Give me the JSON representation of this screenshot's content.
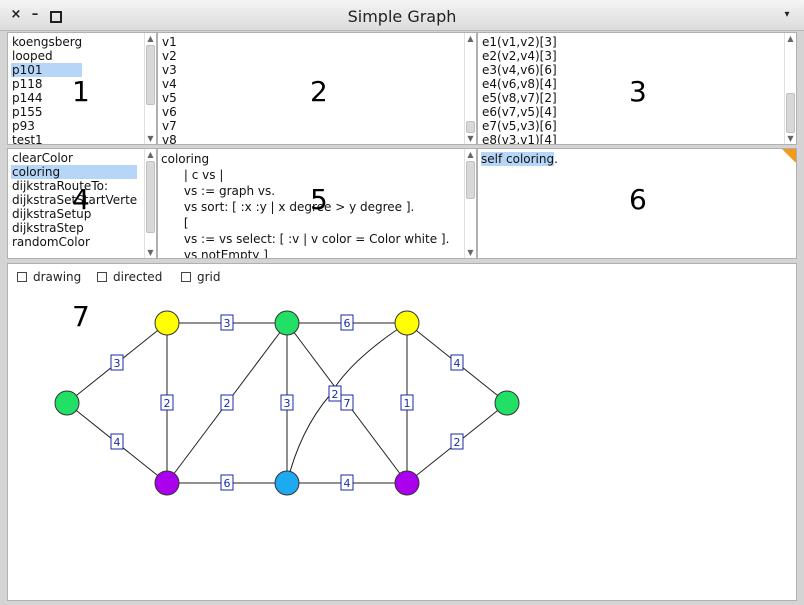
{
  "window": {
    "title": "Simple Graph",
    "close_glyph": "×",
    "minimize_glyph": "–",
    "menu_glyph": "▾"
  },
  "graphs_list": {
    "number_label": "1",
    "items": [
      "koengsberg",
      "looped",
      "p101",
      "p118",
      "p144",
      "p155",
      "p93",
      "test1"
    ],
    "selected_index": 2
  },
  "vertices_list": {
    "number_label": "2",
    "items": [
      "v1",
      "v2",
      "v3",
      "v4",
      "v5",
      "v6",
      "v7",
      "v8"
    ]
  },
  "edges_list": {
    "number_label": "3",
    "items": [
      "e1(v1,v2)[3]",
      "e2(v2,v4)[3]",
      "e3(v4,v6)[6]",
      "e4(v6,v8)[4]",
      "e5(v8,v7)[2]",
      "e6(v7,v5)[4]",
      "e7(v5,v3)[6]",
      "e8(v3,v1)[4]"
    ]
  },
  "methods_list": {
    "number_label": "4",
    "items": [
      "clearColor",
      "coloring",
      "dijkstraRouteTo:",
      "dijkstraSetStartVerte",
      "dijkstraSetup",
      "dijkstraStep",
      "randomColor"
    ],
    "selected_index": 1
  },
  "code_pane": {
    "number_label": "5",
    "lines": [
      "coloring",
      "      | c vs |",
      "      vs := graph vs.",
      "      vs sort: [ :x :y | x degree > y degree ].",
      "      [",
      "      vs := vs select: [ :v | v color = Color white ].",
      "      vs notEmpty ]"
    ]
  },
  "workspace": {
    "number_label": "6",
    "text": "self coloring",
    "trailing": "."
  },
  "canvas": {
    "number_label": "7",
    "options": [
      {
        "label": "drawing",
        "checked": false
      },
      {
        "label": "directed",
        "checked": false
      },
      {
        "label": "grid",
        "checked": false
      }
    ]
  },
  "colors": {
    "yellow": "#ffff00",
    "green": "#22e066",
    "purple": "#aa00ee",
    "blue": "#1eaaf0",
    "selection": "#b6d6f8",
    "edge_label": "#1a2aa8",
    "corner": "#f39a1b"
  },
  "graph": {
    "nodes": [
      {
        "id": "left",
        "color": "green"
      },
      {
        "id": "top1",
        "color": "yellow"
      },
      {
        "id": "bot1",
        "color": "purple"
      },
      {
        "id": "top2",
        "color": "green"
      },
      {
        "id": "bot2",
        "color": "blue"
      },
      {
        "id": "top3",
        "color": "yellow"
      },
      {
        "id": "bot3",
        "color": "purple"
      },
      {
        "id": "right",
        "color": "green"
      }
    ],
    "edges": [
      {
        "from": "left",
        "to": "top1",
        "weight": "3"
      },
      {
        "from": "left",
        "to": "bot1",
        "weight": "4"
      },
      {
        "from": "top1",
        "to": "bot1",
        "weight": "2"
      },
      {
        "from": "top1",
        "to": "top2",
        "weight": "3"
      },
      {
        "from": "bot1",
        "to": "top2",
        "weight": "2"
      },
      {
        "from": "bot1",
        "to": "bot2",
        "weight": "6"
      },
      {
        "from": "top2",
        "to": "top3",
        "weight": "6"
      },
      {
        "from": "top2",
        "to": "bot2",
        "weight": "3"
      },
      {
        "from": "top2",
        "to": "bot3",
        "weight": "7"
      },
      {
        "from": "bot2",
        "to": "top3",
        "weight": "2"
      },
      {
        "from": "bot2",
        "to": "bot3",
        "weight": "4"
      },
      {
        "from": "top3",
        "to": "bot3",
        "weight": "1"
      },
      {
        "from": "top3",
        "to": "right",
        "weight": "4"
      },
      {
        "from": "bot3",
        "to": "right",
        "weight": "2"
      }
    ]
  }
}
